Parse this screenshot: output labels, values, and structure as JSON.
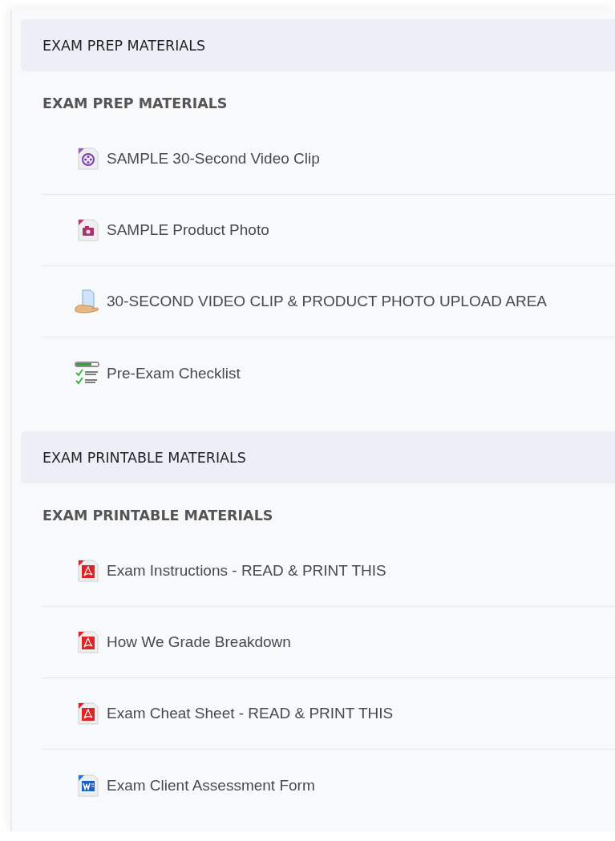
{
  "sections": [
    {
      "title": "EXAM PREP MATERIALS",
      "subheading": "EXAM PREP MATERIALS",
      "items": [
        {
          "kind": "video",
          "label": "SAMPLE 30-Second Video Clip"
        },
        {
          "kind": "image",
          "label": "SAMPLE Product Photo"
        },
        {
          "kind": "upload",
          "label": "30-SECOND VIDEO CLIP & PRODUCT PHOTO UPLOAD AREA"
        },
        {
          "kind": "checklist",
          "label": "Pre-Exam Checklist"
        }
      ]
    },
    {
      "title": "EXAM PRINTABLE MATERIALS",
      "subheading": "EXAM PRINTABLE MATERIALS",
      "items": [
        {
          "kind": "pdf",
          "label": "Exam Instructions - READ & PRINT THIS"
        },
        {
          "kind": "pdf",
          "label": "How We Grade Breakdown"
        },
        {
          "kind": "pdf",
          "label": "Exam Cheat Sheet - READ & PRINT THIS"
        },
        {
          "kind": "word",
          "label": "Exam Client Assessment Form"
        }
      ]
    }
  ]
}
